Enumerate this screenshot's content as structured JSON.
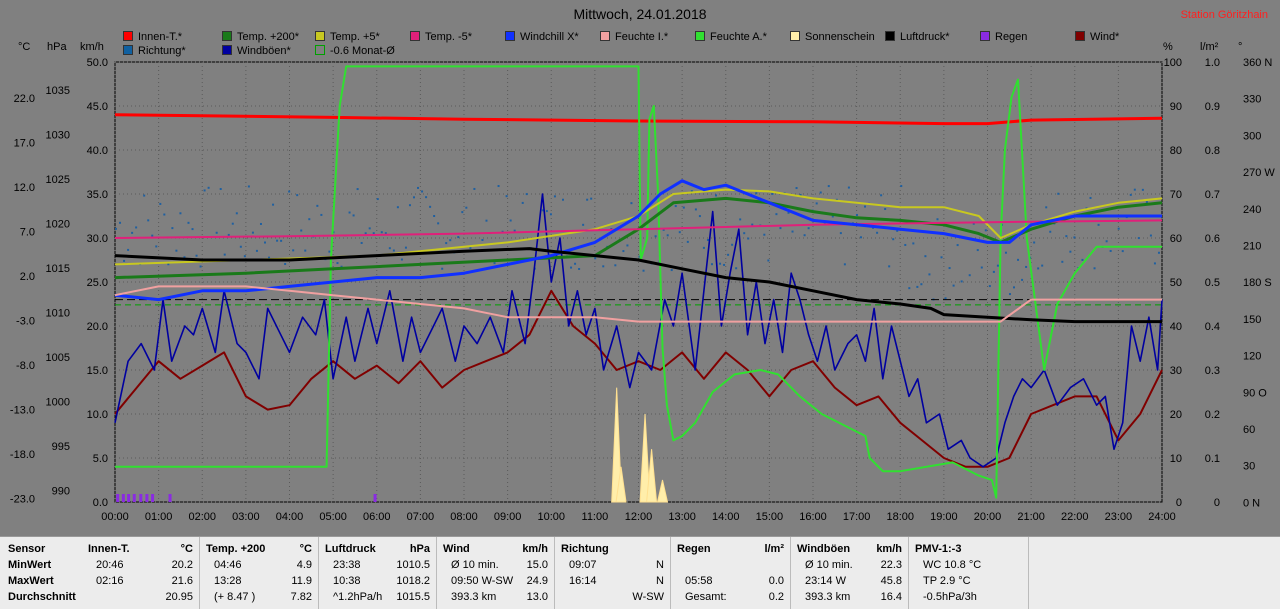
{
  "header": {
    "title": "Mittwoch, 24.01.2018",
    "station": "Station Göritzhain"
  },
  "legend": [
    {
      "label": "Innen-T.*",
      "color": "#ff0000"
    },
    {
      "label": "Temp. +200*",
      "color": "#1a7a1a"
    },
    {
      "label": "Temp. +5*",
      "color": "#c8c820"
    },
    {
      "label": "Temp. -5*",
      "color": "#e0207a"
    },
    {
      "label": "Windchill X*",
      "color": "#1030ff"
    },
    {
      "label": "Feuchte I.*",
      "color": "#f0a0a0"
    },
    {
      "label": "Feuchte A.*",
      "color": "#30e030"
    },
    {
      "label": "Sonnenschein",
      "color": "#ffeeaa"
    },
    {
      "label": "Luftdruck*",
      "color": "#000000"
    },
    {
      "label": "Regen",
      "color": "#8a2be2"
    },
    {
      "label": "Wind*",
      "color": "#800000"
    },
    {
      "label": "Richtung*",
      "color": "#1060a0"
    },
    {
      "label": "Windböen*",
      "color": "#0000a0"
    },
    {
      "label": "-0.6 Monat-Ø",
      "color": "#00a000"
    }
  ],
  "units": {
    "c": "°C",
    "hpa": "hPa",
    "kmh": "km/h",
    "pct": "%",
    "lm2": "l/m²",
    "deg": "°"
  },
  "chart_data": {
    "type": "line",
    "title": "Mittwoch, 24.01.2018",
    "x_ticks": [
      "00:00",
      "01:00",
      "02:00",
      "03:00",
      "04:00",
      "05:00",
      "06:00",
      "07:00",
      "08:00",
      "09:00",
      "10:00",
      "11:00",
      "12:00",
      "13:00",
      "14:00",
      "15:00",
      "16:00",
      "17:00",
      "18:00",
      "19:00",
      "20:00",
      "21:00",
      "22:00",
      "23:00",
      "24:00"
    ],
    "axes": {
      "temp": {
        "label": "°C",
        "ticks": [
          "22.0",
          "17.0",
          "12.0",
          "7.0",
          "2.0",
          "-3.0",
          "-8.0",
          "-13.0",
          "-18.0",
          "-23.0"
        ],
        "range": [
          -23,
          27
        ]
      },
      "pressure": {
        "label": "hPa",
        "ticks": [
          "1035",
          "1030",
          "1025",
          "1020",
          "1015",
          "1010",
          "1005",
          "1000",
          "995",
          "990"
        ],
        "range": [
          990,
          1040
        ]
      },
      "wind": {
        "label": "km/h",
        "ticks": [
          "50.0",
          "45.0",
          "40.0",
          "35.0",
          "30.0",
          "25.0",
          "20.0",
          "15.0",
          "10.0",
          "5.0",
          "0.0"
        ],
        "range": [
          0,
          50
        ]
      },
      "humidity": {
        "label": "%",
        "ticks": [
          "100",
          "90",
          "80",
          "70",
          "60",
          "50",
          "40",
          "30",
          "20",
          "10",
          "0"
        ],
        "range": [
          0,
          100
        ]
      },
      "rain": {
        "label": "l/m²",
        "ticks": [
          "1.0",
          "0.9",
          "0.8",
          "0.7",
          "0.6",
          "0.5",
          "0.4",
          "0.3",
          "0.2",
          "0.1",
          "0"
        ],
        "range": [
          0,
          1
        ]
      },
      "direction": {
        "label": "°",
        "ticks": [
          "360 N",
          "330",
          "300",
          "270 W",
          "240",
          "210",
          "180 S",
          "150",
          "120",
          "90 O",
          "60",
          "30",
          "0 N"
        ],
        "range": [
          0,
          360
        ]
      }
    },
    "series": [
      {
        "name": "Innen-T.*",
        "axis": "temp",
        "x": [
          0,
          2,
          5,
          8,
          12,
          16,
          19,
          20,
          21,
          24
        ],
        "y": [
          21.0,
          20.9,
          20.7,
          20.5,
          20.3,
          20.2,
          20.0,
          20.0,
          20.4,
          20.6
        ]
      },
      {
        "name": "Feuchte A.*",
        "axis": "humidity",
        "x": [
          0,
          4.85,
          4.95,
          5.15,
          5.3,
          12.0,
          12.05,
          12.2,
          12.25,
          12.35,
          12.45,
          12.55,
          12.65,
          12.8,
          13.0,
          13.3,
          13.7,
          14.2,
          14.8,
          15.2,
          15.7,
          16.2,
          17.0,
          17.2,
          17.3,
          17.6,
          18.0,
          19.2,
          19.8,
          20.1,
          20.2,
          20.3,
          20.4,
          20.55,
          20.7,
          20.9,
          21.3,
          21.6,
          22.0,
          22.5,
          23.0,
          24.0
        ],
        "y": [
          8,
          8,
          55,
          90,
          99,
          99,
          55,
          60,
          87,
          90,
          70,
          35,
          22,
          14,
          15,
          18,
          25,
          29,
          30,
          29,
          24,
          20,
          16,
          15,
          10,
          7,
          7,
          9,
          6,
          5,
          1,
          60,
          80,
          92,
          96,
          60,
          30,
          45,
          52,
          58,
          58,
          58
        ]
      },
      {
        "name": "Temp. +5*",
        "axis": "temp",
        "x": [
          0,
          3,
          6,
          9,
          11,
          12,
          12.8,
          14,
          15,
          16,
          17,
          18,
          19,
          19.8,
          20.3,
          21,
          22,
          23,
          24
        ],
        "y": [
          4.0,
          4.5,
          5.0,
          6.5,
          8.0,
          9.5,
          12.0,
          12.5,
          12.3,
          11.5,
          11.0,
          10.5,
          10.5,
          9.5,
          7.0,
          8.5,
          10.0,
          11.0,
          11.5
        ]
      },
      {
        "name": "Temp. +200*",
        "axis": "temp",
        "x": [
          0,
          3,
          5,
          7,
          9,
          11,
          11.5,
          12,
          12.8,
          14,
          15,
          16,
          17,
          18,
          19,
          19.8,
          20.3,
          21,
          22,
          23,
          24
        ],
        "y": [
          2.5,
          3.0,
          3.5,
          4.0,
          4.5,
          5.0,
          6.5,
          8.0,
          11.0,
          11.5,
          11.0,
          10.0,
          9.3,
          9.0,
          8.5,
          7.5,
          6.5,
          8.0,
          9.5,
          10.5,
          11.0
        ]
      },
      {
        "name": "Temp. -5*",
        "axis": "temp",
        "x": [
          0,
          4,
          8,
          12,
          16,
          20,
          24
        ],
        "y": [
          7.0,
          7.2,
          7.5,
          8.0,
          8.5,
          8.8,
          9.0
        ]
      },
      {
        "name": "Windchill X*",
        "axis": "temp",
        "x": [
          0,
          1,
          2,
          3,
          4,
          5,
          6,
          7,
          8,
          9,
          10,
          11,
          12,
          12.5,
          13,
          13.5,
          14,
          14.5,
          15,
          16,
          17,
          18,
          19,
          19.5,
          20,
          20.5,
          21,
          22,
          23,
          24
        ],
        "y": [
          0.5,
          0.0,
          1.0,
          1.0,
          1.5,
          2.0,
          2.5,
          2.5,
          3.0,
          4.0,
          5.0,
          6.5,
          9.5,
          12.0,
          13.5,
          12.5,
          13.0,
          12.0,
          11.0,
          9.0,
          8.5,
          8.0,
          7.5,
          7.0,
          6.5,
          6.5,
          8.5,
          9.5,
          9.5,
          9.5
        ]
      },
      {
        "name": "Luftdruck*",
        "axis": "pressure",
        "x": [
          0,
          2,
          4,
          6,
          8,
          9.5,
          10,
          11,
          12,
          13,
          14,
          15,
          16,
          17,
          18,
          18.7,
          19,
          20,
          21,
          22,
          23,
          24
        ],
        "y": [
          1018.0,
          1017.5,
          1017.5,
          1018.0,
          1018.5,
          1018.8,
          1018.5,
          1018.0,
          1017.5,
          1016.5,
          1015.5,
          1015.0,
          1014.0,
          1013.0,
          1012.5,
          1012.0,
          1011.3,
          1011.0,
          1010.7,
          1010.5,
          1010.5,
          1010.5
        ]
      },
      {
        "name": "Feuchte I.*",
        "axis": "humidity",
        "x": [
          0,
          1,
          2,
          3,
          4,
          5,
          6,
          7,
          8,
          8.5,
          9,
          10,
          11,
          12,
          13,
          14,
          15,
          16,
          17,
          18,
          19,
          20,
          20.3,
          21,
          22,
          23,
          24
        ],
        "y": [
          47,
          49,
          49,
          49,
          48,
          47,
          46,
          45,
          44,
          43,
          42,
          42,
          42,
          41,
          41,
          41,
          41,
          41,
          41,
          41,
          41,
          41,
          41,
          46,
          46,
          46,
          46
        ]
      },
      {
        "name": "-0.6 Monat-Ø",
        "axis": "temp",
        "dashed": true,
        "x": [
          0,
          24
        ],
        "y": [
          -0.6,
          -0.6
        ]
      },
      {
        "name": "Luftdruck ref",
        "axis": "pressure",
        "dashed": true,
        "black": true,
        "x": [
          0,
          24
        ],
        "y": [
          1013.0,
          1013.0
        ]
      }
    ],
    "wind_avg_points": [
      [
        0,
        10
      ],
      [
        0.5,
        13
      ],
      [
        1,
        16
      ],
      [
        1.5,
        14
      ],
      [
        2,
        15.5
      ],
      [
        2.5,
        17
      ],
      [
        3,
        12
      ],
      [
        3.5,
        10.5
      ],
      [
        4,
        11
      ],
      [
        4.5,
        14
      ],
      [
        5,
        16
      ],
      [
        5.5,
        14
      ],
      [
        6,
        15.5
      ],
      [
        6.5,
        13.5
      ],
      [
        7,
        16
      ],
      [
        7.5,
        13
      ],
      [
        8,
        15
      ],
      [
        8.5,
        16
      ],
      [
        9,
        17
      ],
      [
        9.5,
        19
      ],
      [
        10,
        24
      ],
      [
        10.5,
        20
      ],
      [
        11,
        18
      ],
      [
        11.5,
        15
      ],
      [
        12,
        16
      ],
      [
        12.5,
        15
      ],
      [
        13,
        17
      ],
      [
        13.5,
        14
      ],
      [
        14,
        17
      ],
      [
        14.5,
        15
      ],
      [
        15,
        12
      ],
      [
        15.5,
        15
      ],
      [
        16,
        16
      ],
      [
        16.5,
        13
      ],
      [
        17,
        11
      ],
      [
        17.5,
        12
      ],
      [
        18,
        9
      ],
      [
        18.5,
        7
      ],
      [
        19,
        5
      ],
      [
        19.5,
        4
      ],
      [
        20,
        4
      ],
      [
        20.5,
        5
      ],
      [
        21,
        10
      ],
      [
        21.5,
        11
      ],
      [
        22,
        12
      ],
      [
        22.5,
        12
      ],
      [
        23,
        7
      ],
      [
        23.5,
        10
      ],
      [
        24,
        15
      ]
    ],
    "wind_gust_points": [
      [
        0,
        9
      ],
      [
        0.3,
        16
      ],
      [
        0.6,
        18
      ],
      [
        0.9,
        15
      ],
      [
        1.1,
        23
      ],
      [
        1.3,
        16
      ],
      [
        1.6,
        20
      ],
      [
        1.8,
        19
      ],
      [
        2.0,
        22
      ],
      [
        2.3,
        17
      ],
      [
        2.5,
        24
      ],
      [
        2.8,
        18
      ],
      [
        3.0,
        17
      ],
      [
        3.3,
        14
      ],
      [
        3.5,
        22
      ],
      [
        3.8,
        19
      ],
      [
        4.0,
        17
      ],
      [
        4.3,
        21
      ],
      [
        4.6,
        19
      ],
      [
        4.8,
        23
      ],
      [
        5.0,
        14
      ],
      [
        5.3,
        21
      ],
      [
        5.5,
        16
      ],
      [
        5.8,
        22
      ],
      [
        6.0,
        18
      ],
      [
        6.3,
        24
      ],
      [
        6.6,
        16
      ],
      [
        6.8,
        21
      ],
      [
        7.0,
        17
      ],
      [
        7.3,
        20
      ],
      [
        7.5,
        22
      ],
      [
        7.8,
        16
      ],
      [
        8.0,
        20
      ],
      [
        8.3,
        18
      ],
      [
        8.6,
        21
      ],
      [
        8.9,
        17
      ],
      [
        9.1,
        24
      ],
      [
        9.4,
        18
      ],
      [
        9.6,
        26
      ],
      [
        9.8,
        35
      ],
      [
        10.0,
        25
      ],
      [
        10.2,
        30
      ],
      [
        10.4,
        20
      ],
      [
        10.6,
        24
      ],
      [
        10.8,
        19
      ],
      [
        11.0,
        22
      ],
      [
        11.2,
        15
      ],
      [
        11.5,
        20
      ],
      [
        11.8,
        13
      ],
      [
        12.0,
        17
      ],
      [
        12.3,
        15
      ],
      [
        12.6,
        23
      ],
      [
        12.8,
        20
      ],
      [
        13.0,
        26
      ],
      [
        13.3,
        15
      ],
      [
        13.5,
        24
      ],
      [
        13.7,
        33
      ],
      [
        13.9,
        20
      ],
      [
        14.1,
        26
      ],
      [
        14.3,
        31
      ],
      [
        14.5,
        19
      ],
      [
        14.7,
        25
      ],
      [
        14.9,
        18
      ],
      [
        15.1,
        23
      ],
      [
        15.3,
        17
      ],
      [
        15.5,
        26
      ],
      [
        15.7,
        23
      ],
      [
        15.9,
        19
      ],
      [
        16.1,
        16
      ],
      [
        16.3,
        20
      ],
      [
        16.5,
        15
      ],
      [
        16.8,
        18
      ],
      [
        17.0,
        19
      ],
      [
        17.2,
        16
      ],
      [
        17.4,
        22
      ],
      [
        17.6,
        14
      ],
      [
        17.8,
        20
      ],
      [
        18.0,
        16
      ],
      [
        18.2,
        12
      ],
      [
        18.4,
        14
      ],
      [
        18.6,
        9
      ],
      [
        18.9,
        10
      ],
      [
        19.1,
        6
      ],
      [
        19.4,
        7
      ],
      [
        19.6,
        5
      ],
      [
        19.9,
        4
      ],
      [
        20.2,
        5
      ],
      [
        20.4,
        9
      ],
      [
        20.6,
        12
      ],
      [
        20.8,
        14
      ],
      [
        21.0,
        13
      ],
      [
        21.3,
        15
      ],
      [
        21.6,
        11
      ],
      [
        21.9,
        13
      ],
      [
        22.2,
        14
      ],
      [
        22.5,
        11
      ],
      [
        22.7,
        12
      ],
      [
        22.9,
        6
      ],
      [
        23.1,
        9
      ],
      [
        23.3,
        20
      ],
      [
        23.5,
        16
      ],
      [
        23.7,
        21
      ],
      [
        23.9,
        15
      ],
      [
        24.0,
        23
      ]
    ],
    "direction_dots_hint": "scattered around 220-260°",
    "sunshine_peaks": [
      [
        11.5,
        0.26
      ],
      [
        11.6,
        0.08
      ],
      [
        12.15,
        0.2
      ],
      [
        12.3,
        0.12
      ],
      [
        12.55,
        0.05
      ]
    ],
    "rain_bars": [
      0.05,
      0.18,
      0.3,
      0.43,
      0.58,
      0.72,
      0.85,
      1.25,
      5.95
    ]
  },
  "table": {
    "rows": [
      "Sensor",
      "MinWert",
      "MaxWert",
      "Durchschnitt"
    ],
    "cols": [
      {
        "head": "Innen-T.",
        "unit": "°C",
        "vals": [
          [
            "20:46",
            "20.2"
          ],
          [
            "02:16",
            "21.6"
          ],
          [
            "",
            "20.95"
          ]
        ]
      },
      {
        "head": "Temp. +200",
        "unit": "°C",
        "vals": [
          [
            "04:46",
            "4.9"
          ],
          [
            "13:28",
            "11.9"
          ],
          [
            "(+ 8.47 )",
            "7.82"
          ]
        ]
      },
      {
        "head": "Luftdruck",
        "unit": "hPa",
        "vals": [
          [
            "23:38",
            "1010.5"
          ],
          [
            "10:38",
            "1018.2"
          ],
          [
            "^1.2hPa/h",
            "1015.5"
          ]
        ]
      },
      {
        "head": "Wind",
        "unit": "km/h",
        "vals": [
          [
            "Ø 10 min.",
            "15.0"
          ],
          [
            "09:50   W-SW",
            "24.9"
          ],
          [
            "393.3 km",
            "13.0"
          ]
        ]
      },
      {
        "head": "Richtung",
        "unit": "",
        "vals": [
          [
            "09:07",
            "N"
          ],
          [
            "16:14",
            "N"
          ],
          [
            "",
            "W-SW"
          ]
        ]
      },
      {
        "head": "Regen",
        "unit": "l/m²",
        "vals": [
          [
            "",
            ""
          ],
          [
            "05:58",
            "0.0"
          ],
          [
            "Gesamt:",
            "0.2"
          ]
        ]
      },
      {
        "head": "Windböen",
        "unit": "km/h",
        "vals": [
          [
            "Ø 10 min.",
            "22.3"
          ],
          [
            "23:14     W",
            "45.8"
          ],
          [
            "393.3 km",
            "16.4"
          ]
        ]
      },
      {
        "head": "PMV-1:-3",
        "unit": "",
        "vals": [
          [
            "WC 10.8 °C",
            ""
          ],
          [
            "TP 2.9 °C",
            ""
          ],
          [
            "-0.5hPa/3h",
            ""
          ]
        ]
      }
    ]
  }
}
